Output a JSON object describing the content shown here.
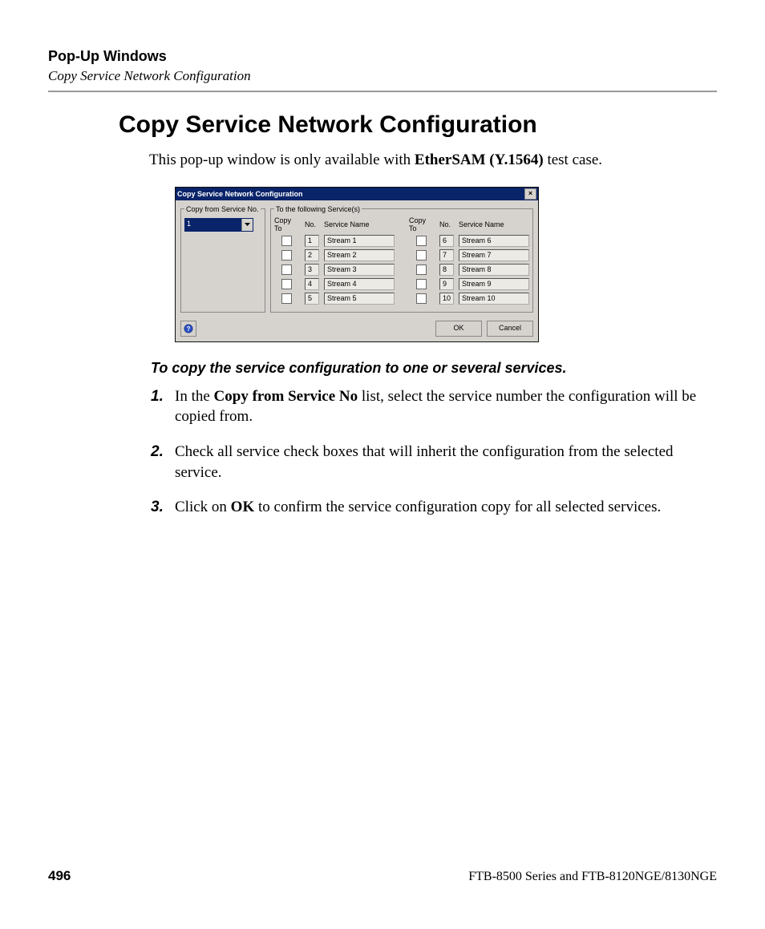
{
  "header": {
    "section": "Pop-Up Windows",
    "subsection": "Copy Service Network Configuration"
  },
  "title": "Copy Service Network Configuration",
  "intro_prefix": "This pop-up window is only available with ",
  "intro_bold": "EtherSAM (Y.1564)",
  "intro_suffix": " test case.",
  "dialog": {
    "title": "Copy Service Network Configuration",
    "from_legend": "Copy from Service No.",
    "from_value": "1",
    "to_legend": "To the following Service(s)",
    "col_copyto": "Copy To",
    "col_no": "No.",
    "col_name": "Service Name",
    "left": [
      {
        "no": "1",
        "name": "Stream 1"
      },
      {
        "no": "2",
        "name": "Stream 2"
      },
      {
        "no": "3",
        "name": "Stream 3"
      },
      {
        "no": "4",
        "name": "Stream 4"
      },
      {
        "no": "5",
        "name": "Stream 5"
      }
    ],
    "right": [
      {
        "no": "6",
        "name": "Stream 6"
      },
      {
        "no": "7",
        "name": "Stream 7"
      },
      {
        "no": "8",
        "name": "Stream 8"
      },
      {
        "no": "9",
        "name": "Stream 9"
      },
      {
        "no": "10",
        "name": "Stream 10"
      }
    ],
    "ok": "OK",
    "cancel": "Cancel"
  },
  "subheading": "To copy the service configuration to one or several services.",
  "steps": {
    "s1_a": "In the ",
    "s1_b": "Copy from Service No",
    "s1_c": " list, select the service number the configuration will be copied from.",
    "s2": "Check all service check boxes that will inherit the configuration from the selected service.",
    "s3_a": "Click on ",
    "s3_b": "OK",
    "s3_c": " to confirm the service configuration copy for all selected services."
  },
  "footer": {
    "page": "496",
    "product": "FTB-8500 Series and FTB-8120NGE/8130NGE"
  }
}
